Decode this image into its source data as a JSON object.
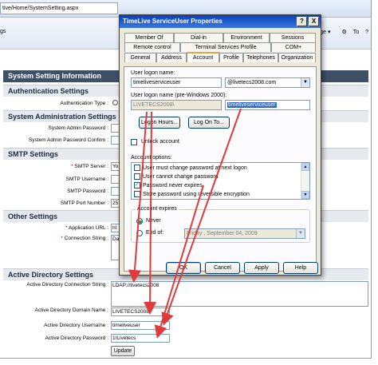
{
  "browser": {
    "url": "tive/Home/SystemSetting.aspx",
    "page_tab": "gs",
    "toolbar": {
      "page": "Page",
      "tools": "To"
    }
  },
  "page": {
    "section_system": "System Setting Information",
    "section_auth": "Authentication Settings",
    "auth_type_label": "Authentication Type :",
    "section_admin": "System Administration Settings",
    "admin_password_label": "System Admin Password :",
    "admin_confirm_label": "System Admin Password Confirm :",
    "section_smtp": "SMTP Settings",
    "smtp_server_label": "SMTP Server :",
    "smtp_server_value": "Yo",
    "smtp_username_label": "SMTP Username :",
    "smtp_password_label": "SMTP Password :",
    "smtp_port_label": "SMTP Port Number :",
    "smtp_port_value": "25",
    "section_other": "Other Settings",
    "app_url_label": "Application URL :",
    "app_url_value": "ht",
    "conn_string_label": "Connection String :",
    "conn_string_value": "Da",
    "section_ad": "Active Directory Settings",
    "ad_conn_label": "Active Directory Connection String :",
    "ad_conn_value": "LDAP://livetecs2008",
    "ad_domain_label": "Active Directory Domain Name :",
    "ad_domain_value": "LIVETECS2008",
    "ad_user_label": "Active Directory Username :",
    "ad_user_value": "timeliveuser",
    "ad_password_label": "Active Directory Password :",
    "ad_password_value": "1!Livetecs",
    "update_button": "Update"
  },
  "dialog": {
    "title": "TimeLive ServiceUser Properties",
    "help_glyph": "?",
    "close_glyph": "X",
    "tabs_row1": [
      "Member Of",
      "Dial-in",
      "Environment",
      "Sessions"
    ],
    "tabs_row2": [
      "Remote control",
      "Terminal Services Profile",
      "COM+"
    ],
    "tabs_row3": [
      "General",
      "Address",
      "Account",
      "Profile",
      "Telephones",
      "Organization"
    ],
    "active_tab": "Account",
    "logon_name_label": "User logon name:",
    "logon_name_value": "timeliveserviceuser",
    "domain_value": "@livetecs2008.com",
    "pre2000_label": "User logon name (pre-Windows 2000):",
    "pre2000_domain": "LIVETECS2008\\",
    "pre2000_user": "timeliveserviceuser",
    "logon_hours_button": "Logon Hours...",
    "logon_to_button": "Log On To...",
    "unlock_label": "Unlock account",
    "account_options_label": "Account options:",
    "options": [
      {
        "label": "User must change password at next logon",
        "checked": false
      },
      {
        "label": "User cannot change password",
        "checked": false
      },
      {
        "label": "Password never expires",
        "checked": true
      },
      {
        "label": "Store password using reversible encryption",
        "checked": false
      }
    ],
    "expires_label": "Account expires",
    "never_label": "Never",
    "endof_label": "End of:",
    "expiry_date": "Friday    ,  September 04, 2009",
    "ok_button": "OK",
    "cancel_button": "Cancel",
    "apply_button": "Apply",
    "help_button": "Help"
  },
  "colors": {
    "arrow": "#e03a3a",
    "section_dark": "#3f4f66",
    "titlebar": "#0c3fb8",
    "selection": "#316ac5"
  }
}
